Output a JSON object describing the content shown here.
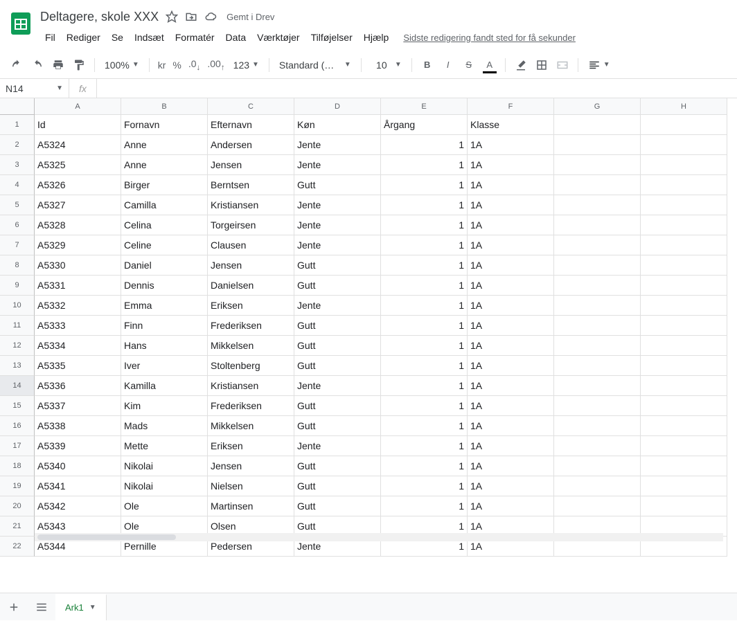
{
  "header": {
    "title": "Deltagere, skole XXX",
    "saved_label": "Gemt i Drev",
    "last_edit": "Sidste redigering fandt sted for få sekunder"
  },
  "menu": {
    "items": [
      "Fil",
      "Rediger",
      "Se",
      "Indsæt",
      "Formatér",
      "Data",
      "Værktøjer",
      "Tilføjelser",
      "Hjælp"
    ]
  },
  "toolbar": {
    "zoom": "100%",
    "currency": "kr",
    "percent": "%",
    "dec_dec": ".0",
    "inc_dec": ".00",
    "numfmt": "123",
    "font": "Standard (…",
    "font_size": "10"
  },
  "formula_bar": {
    "name_box": "N14",
    "fx": "fx",
    "formula": ""
  },
  "sheet": {
    "columns": [
      "A",
      "B",
      "C",
      "D",
      "E",
      "F",
      "G",
      "H"
    ],
    "headers": [
      "Id",
      "Fornavn",
      "Efternavn",
      "Køn",
      "Årgang",
      "Klasse"
    ],
    "rows": [
      [
        "A5324",
        "Anne",
        "Andersen",
        "Jente",
        "1",
        "1A"
      ],
      [
        "A5325",
        "Anne",
        "Jensen",
        "Jente",
        "1",
        "1A"
      ],
      [
        "A5326",
        "Birger",
        "Berntsen",
        "Gutt",
        "1",
        "1A"
      ],
      [
        "A5327",
        "Camilla",
        "Kristiansen",
        "Jente",
        "1",
        "1A"
      ],
      [
        "A5328",
        "Celina",
        "Torgeirsen",
        "Jente",
        "1",
        "1A"
      ],
      [
        "A5329",
        "Celine",
        "Clausen",
        "Jente",
        "1",
        "1A"
      ],
      [
        "A5330",
        "Daniel",
        "Jensen",
        "Gutt",
        "1",
        "1A"
      ],
      [
        "A5331",
        "Dennis",
        "Danielsen",
        "Gutt",
        "1",
        "1A"
      ],
      [
        "A5332",
        "Emma",
        "Eriksen",
        "Jente",
        "1",
        "1A"
      ],
      [
        "A5333",
        "Finn",
        "Frederiksen",
        "Gutt",
        "1",
        "1A"
      ],
      [
        "A5334",
        "Hans",
        "Mikkelsen",
        "Gutt",
        "1",
        "1A"
      ],
      [
        "A5335",
        "Iver",
        "Stoltenberg",
        "Gutt",
        "1",
        "1A"
      ],
      [
        "A5336",
        "Kamilla",
        "Kristiansen",
        "Jente",
        "1",
        "1A"
      ],
      [
        "A5337",
        "Kim",
        "Frederiksen",
        "Gutt",
        "1",
        "1A"
      ],
      [
        "A5338",
        "Mads",
        "Mikkelsen",
        "Gutt",
        "1",
        "1A"
      ],
      [
        "A5339",
        "Mette",
        "Eriksen",
        "Jente",
        "1",
        "1A"
      ],
      [
        "A5340",
        "Nikolai",
        "Jensen",
        "Gutt",
        "1",
        "1A"
      ],
      [
        "A5341",
        "Nikolai",
        "Nielsen",
        "Gutt",
        "1",
        "1A"
      ],
      [
        "A5342",
        "Ole",
        "Martinsen",
        "Gutt",
        "1",
        "1A"
      ],
      [
        "A5343",
        "Ole",
        "Olsen",
        "Gutt",
        "1",
        "1A"
      ],
      [
        "A5344",
        "Pernille",
        "Pedersen",
        "Jente",
        "1",
        "1A"
      ]
    ],
    "highlighted_row": 14,
    "numeric_cols": [
      4
    ]
  },
  "footer": {
    "tab_name": "Ark1"
  }
}
